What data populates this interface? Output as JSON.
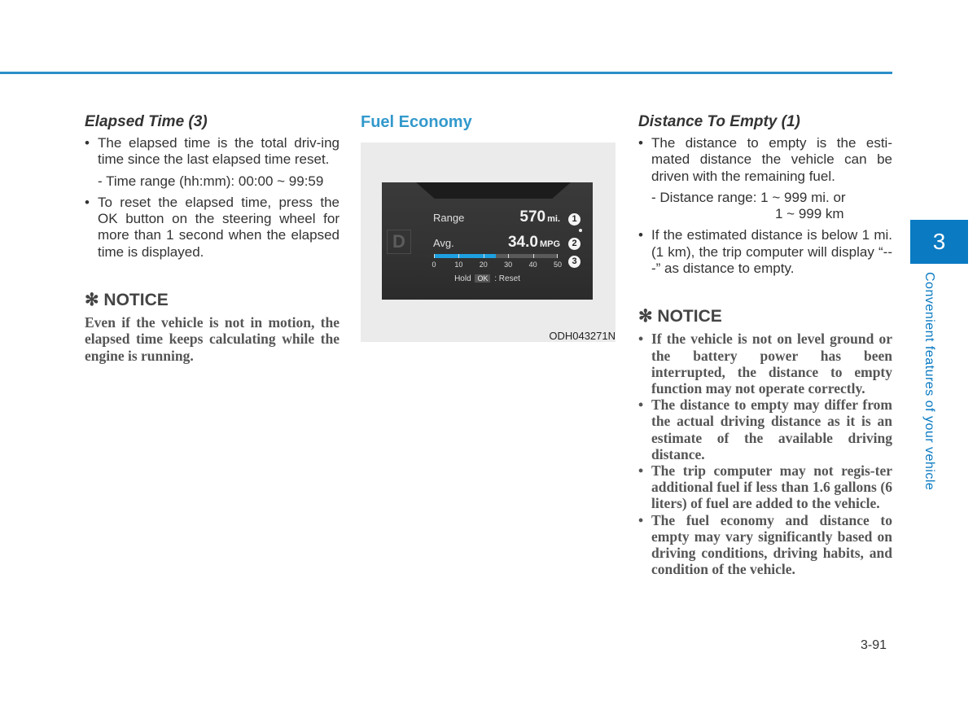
{
  "header": {
    "rule_color": "#2b8fc8"
  },
  "left_column": {
    "heading": "Elapsed Time (3)",
    "bullet1": "The elapsed time is the total driv-ing time since the last elapsed time reset.",
    "subline": "- Time range (hh:mm): 00:00 ~ 99:59",
    "bullet2": "To reset the elapsed time, press the OK button on the steering wheel for more than 1 second when the elapsed time is displayed.",
    "notice_heading": "✻ NOTICE",
    "notice_text": "Even if the vehicle is not in motion, the elapsed time keeps calculating while the engine is running."
  },
  "middle_column": {
    "heading": "Fuel Economy",
    "figure": {
      "gear": "D",
      "range_label": "Range",
      "range_value": "570",
      "range_unit": "mi.",
      "avg_label": "Avg.",
      "avg_value": "34.0",
      "avg_unit": "MPG",
      "gauge_min": 0,
      "gauge_max": 50,
      "gauge_fill_value": 25,
      "gauge_ticks": [
        "0",
        "10",
        "20",
        "30",
        "40",
        "50"
      ],
      "hold_prefix": "Hold",
      "ok_key": "OK",
      "hold_suffix": ": Reset",
      "badges": [
        "1",
        "2",
        "3"
      ],
      "caption": "ODH043271N"
    }
  },
  "right_column": {
    "heading": "Distance To Empty (1)",
    "bullet1": "The distance to empty is the esti-mated distance the vehicle can be driven with the remaining fuel.",
    "subline1": "- Distance range: 1 ~ 999 mi. or",
    "subline2": "1 ~ 999 km",
    "bullet2": "If the estimated distance is below 1 mi. (1 km), the trip computer will display “---” as distance to empty.",
    "notice_heading": "✻ NOTICE",
    "notice_items": [
      "If the vehicle is not on level ground or the battery power has been interrupted, the distance to empty function may not operate correctly.",
      "The distance to empty may differ from the actual driving distance as it is an estimate of the available driving distance.",
      "The trip computer may not regis-ter additional fuel if less than 1.6 gallons (6 liters) of fuel are added to the vehicle.",
      "The fuel economy and distance to empty may vary significantly based on driving conditions, driving habits, and condition of the vehicle."
    ]
  },
  "chapter": {
    "number": "3",
    "title": "Convenient features of your vehicle",
    "color": "#0a7ac2"
  },
  "footer": {
    "page_number": "3-91"
  }
}
